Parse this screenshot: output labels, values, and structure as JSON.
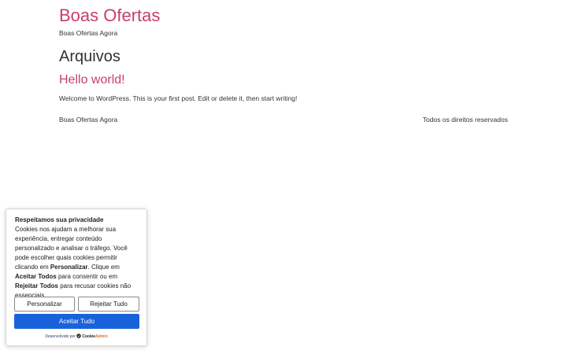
{
  "site": {
    "title": "Boas Ofertas",
    "tagline": "Boas Ofertas Agora"
  },
  "archive": {
    "heading": "Arquivos"
  },
  "post": {
    "title": "Hello world!",
    "excerpt": "Welcome to WordPress. This is your first post. Edit or delete it, then start writing!"
  },
  "footer": {
    "left": "Boas Ofertas Agora",
    "right": "Todos os direitos reservados"
  },
  "cookie_banner": {
    "heading": "Respeitamos sua privacidade",
    "text_part1": "Cookies nos ajudam a melhorar sua experiência, entregar conteúdo personalizado e analisar o tráfego. Você pode escolher quais cookies permitir clicando em ",
    "bold_customize": "Personalizar",
    "text_part2": ". Clique em ",
    "bold_accept": "Aceitar Todos",
    "text_part3": " para consentir ou em ",
    "bold_reject": "Rejeitar Todos",
    "text_part4": " para recusar cookies não essenciais.",
    "customize_label": "Personalizar",
    "reject_label": "Rejeitar Tudo",
    "accept_label": "Aceitar Tudo",
    "powered_by": "Desenvolvido por",
    "brand_part1": "Cookie",
    "brand_part2": "Admin",
    "brand_icon": "cookieyes-shield-icon"
  },
  "colors": {
    "link_pink": "#c93c72",
    "accept_blue": "#1863dc",
    "text_dark": "#333333"
  }
}
